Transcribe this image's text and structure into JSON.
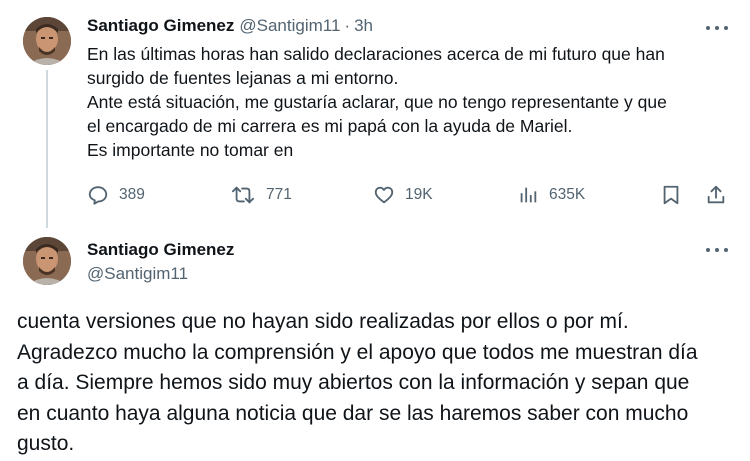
{
  "tweet1": {
    "name": "Santiago Gimenez",
    "handle": "@Santigim11",
    "separator": "·",
    "time": "3h",
    "lines": [
      "En las últimas horas han salido declaraciones acerca de mi futuro que han",
      "surgido de fuentes lejanas a mi entorno.",
      "Ante está situación, me gustaría aclarar, que no tengo representante y que",
      "el encargado de mi carrera es mi papá con la ayuda de Mariel.",
      "Es importante no tomar en"
    ],
    "stats": {
      "replies": "389",
      "retweets": "771",
      "likes": "19K",
      "views": "635K"
    }
  },
  "tweet2": {
    "name": "Santiago Gimenez",
    "handle": "@Santigim11",
    "lines": [
      "cuenta versiones que no hayan sido realizadas por ellos o por mí.",
      "Agradezco mucho la comprensión y el apoyo que todos me muestran día",
      "a día. Siempre hemos sido muy abiertos con la información y sepan que",
      "en cuanto haya alguna noticia que dar se las haremos saber con mucho",
      "gusto."
    ]
  },
  "icons": {
    "reply": "comment-icon",
    "retweet": "retweet-icon",
    "like": "heart-icon",
    "views": "analytics-icon",
    "bookmark": "bookmark-icon",
    "share": "share-icon",
    "more": "more-icon"
  },
  "colors": {
    "text": "#0f1419",
    "secondary": "#536471",
    "thread_line": "#cfd9de"
  }
}
